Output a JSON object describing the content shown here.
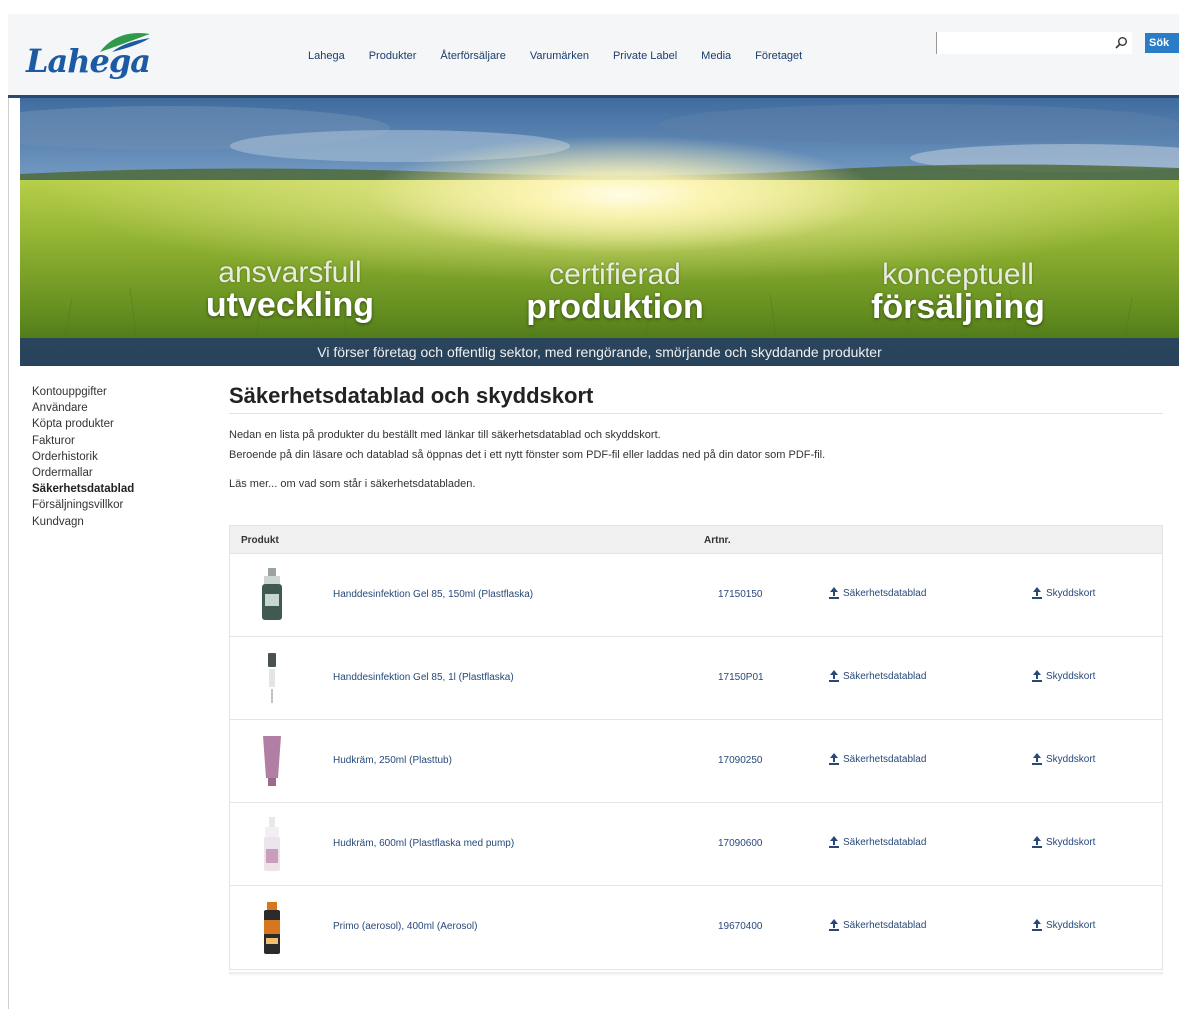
{
  "brand": {
    "logo_text": "Lahega",
    "accent": "#1c5aa3",
    "leaf_color": "#2f9a4a"
  },
  "nav": {
    "items": [
      "Lahega",
      "Produkter",
      "Återförsäljare",
      "Varumärken",
      "Private Label",
      "Media",
      "Företaget"
    ]
  },
  "search": {
    "placeholder": "",
    "value": "",
    "button_label": "Sök",
    "icon": "search-icon"
  },
  "banner": {
    "slogans": [
      {
        "thin": "ansvarsfull",
        "bold": "utveckling"
      },
      {
        "thin": "certifierad",
        "bold": "produktion"
      },
      {
        "thin": "konceptuell",
        "bold": "försäljning"
      }
    ],
    "tagline": "Vi förser företag och offentlig sektor, med rengörande, smörjande och skyddande produkter"
  },
  "sidebar": {
    "items": [
      {
        "label": "Kontouppgifter",
        "active": false
      },
      {
        "label": "Användare",
        "active": false
      },
      {
        "label": "Köpta produkter",
        "active": false
      },
      {
        "label": "Fakturor",
        "active": false
      },
      {
        "label": "Orderhistorik",
        "active": false
      },
      {
        "label": "Ordermallar",
        "active": false
      },
      {
        "label": "Säkerhetsdatablad",
        "active": true
      },
      {
        "label": "Försäljningsvillkor",
        "active": false
      },
      {
        "label": "Kundvagn",
        "active": false
      }
    ]
  },
  "main": {
    "title": "Säkerhetsdatablad och skyddskort",
    "intro_line1": "Nedan en lista på produkter du beställt med länkar till säkerhetsdatablad och skyddskort.",
    "intro_line2": "Beroende på din läsare och datablad så öppnas det i ett nytt fönster som PDF-fil eller laddas ned på din dator som PDF-fil.",
    "readmore_prefix": "Läs mer... ",
    "readmore_link": "om vad som står i säkerhetsdatabladen.",
    "table": {
      "col_product": "Produkt",
      "col_artnr": "Artnr.",
      "sds_label": "Säkerhetsdatablad",
      "skk_label": "Skyddskort",
      "rows": [
        {
          "name": "Handdesinfektion Gel 85, 150ml (Plastflaska)",
          "artnr": "17150150",
          "product_color": "#3f5a52"
        },
        {
          "name": "Handdesinfektion Gel 85, 1l (Plastflaska)",
          "artnr": "17150P01",
          "product_color": "#4a5350"
        },
        {
          "name": "Hudkräm, 250ml (Plasttub)",
          "artnr": "17090250",
          "product_color": "#b27fa4"
        },
        {
          "name": "Hudkräm, 600ml (Plastflaska med pump)",
          "artnr": "17090600",
          "product_color": "#c79fbd"
        },
        {
          "name": "Primo (aerosol), 400ml (Aerosol)",
          "artnr": "19670400",
          "product_color": "#d8761f"
        }
      ]
    }
  }
}
